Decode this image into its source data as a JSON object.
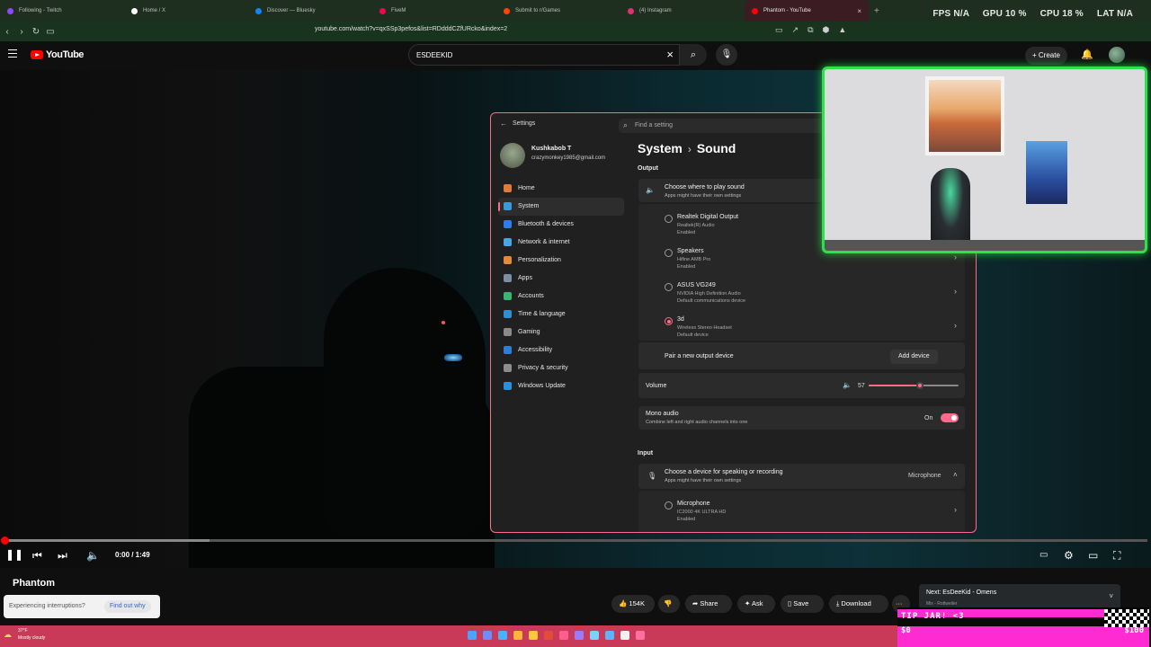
{
  "browser": {
    "tabs": [
      {
        "label": "Following - Twitch",
        "color": "#9146ff"
      },
      {
        "label": "Home / X",
        "color": "#ffffff"
      },
      {
        "label": "Discover — Bluesky",
        "color": "#1185fe"
      },
      {
        "label": "FiveM",
        "color": "#f40552"
      },
      {
        "label": "Submit to r/Games",
        "color": "#ff4500"
      },
      {
        "label": "(4) Instagram",
        "color": "#e1306c"
      },
      {
        "label": "Phantom - YouTube",
        "color": "#ff0000"
      }
    ],
    "close_glyph": "×",
    "newtab_glyph": "+",
    "url": "youtube.com/watch?v=qxSSp3pefos&list=RDdddCZfURcko&index=2",
    "perf": {
      "fps": "FPS N/A",
      "gpu": "GPU 10 %",
      "cpu": "CPU 18 %",
      "lat": "LAT N/A"
    }
  },
  "youtube": {
    "logo": "YouTube",
    "search_value": "ESDEEKID",
    "create_label": "Create"
  },
  "settings": {
    "app_title": "Settings",
    "search_placeholder": "Find a setting",
    "user_name": "Kushkabob T",
    "user_email": "crazymonkey1985@gmail.com",
    "nav": [
      {
        "label": "Home",
        "color": "#e07b39"
      },
      {
        "label": "System",
        "color": "#3a9ad9"
      },
      {
        "label": "Bluetooth & devices",
        "color": "#2b7de9"
      },
      {
        "label": "Network & internet",
        "color": "#4aa6e0"
      },
      {
        "label": "Personalization",
        "color": "#e08a3a"
      },
      {
        "label": "Apps",
        "color": "#7a8fa6"
      },
      {
        "label": "Accounts",
        "color": "#3cb371"
      },
      {
        "label": "Time & language",
        "color": "#2f8fd0"
      },
      {
        "label": "Gaming",
        "color": "#8a8a8a"
      },
      {
        "label": "Accessibility",
        "color": "#2d7fd6"
      },
      {
        "label": "Privacy & security",
        "color": "#8d8d8d"
      },
      {
        "label": "Windows Update",
        "color": "#2b90d9"
      }
    ],
    "breadcrumb_parent": "System",
    "breadcrumb_sep": "›",
    "breadcrumb_current": "Sound",
    "output_label": "Output",
    "choose_output_title": "Choose where to play sound",
    "choose_output_sub": "Apps might have their own settings",
    "devices": [
      {
        "name": "Realtek Digital Output",
        "line1": "Realtek(R) Audio",
        "line2": "Enabled",
        "selected": false
      },
      {
        "name": "Speakers",
        "line1": "Hifine AMB Pro",
        "line2": "Enabled",
        "selected": false
      },
      {
        "name": "ASUS VG249",
        "line1": "NVIDIA High Definition Audio",
        "line2": "Default communications device",
        "selected": false
      },
      {
        "name": "3d",
        "line1": "Wireless Stereo Headset",
        "line2": "Default device",
        "selected": true
      }
    ],
    "pair_label": "Pair a new output device",
    "add_device_label": "Add device",
    "volume_label": "Volume",
    "volume_value": "57",
    "volume_level": 0.57,
    "mono_title": "Mono audio",
    "mono_sub": "Combine left and right audio channels into one",
    "mono_state": "On",
    "input_label": "Input",
    "choose_input_title": "Choose a device for speaking or recording",
    "choose_input_sub": "Apps might have their own settings",
    "input_selected": "Microphone",
    "input_device": {
      "name": "Microphone",
      "line1": "IC2000 4K ULTRA HD",
      "line2": "Enabled"
    }
  },
  "player": {
    "time": "0:00 / 1:49",
    "progress_loaded": 0.18,
    "title": "Phantom",
    "interrupt_text": "Experiencing interruptions?",
    "interrupt_link": "Find out why",
    "likes": "154K",
    "share": "Share",
    "ask": "Ask",
    "save": "Save",
    "download": "Download"
  },
  "overlay": {
    "upnext_title": "Next: EsDeeKid - Omens",
    "upnext_sub": "Mix - Rottweiler",
    "tipjar_label": "TIP JAR! <3",
    "tipjar_current": "$0",
    "tipjar_goal": "$100"
  },
  "taskbar": {
    "temp": "37°F",
    "weather": "Mostly cloudy",
    "icons": [
      "#4aa3ff",
      "#6f8cff",
      "#4ab0ff",
      "#ffb43a",
      "#ffc83a",
      "#e64a3a",
      "#ff5d8f",
      "#9a7bff",
      "#7ad0ff",
      "#5ab4ff",
      "#f0f0f0",
      "#ff6fa1"
    ]
  }
}
